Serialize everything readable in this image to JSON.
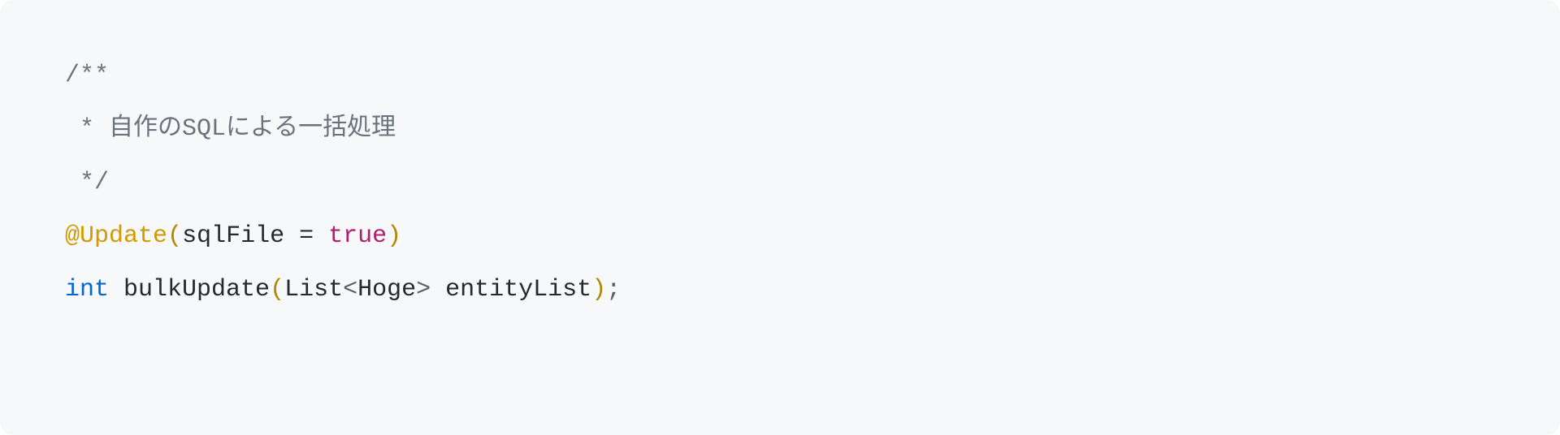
{
  "code": {
    "comment_open": "/**",
    "comment_body": " * 自作のSQLによる一括処理",
    "comment_close": " */",
    "annotation_at": "@",
    "annotation_name": "Update",
    "annotation_param": "sqlFile",
    "annotation_eq": " = ",
    "annotation_value": "true",
    "return_type": "int",
    "method_name": "bulkUpdate",
    "param_type_outer": "List",
    "param_type_inner": "Hoge",
    "param_name": "entityList"
  }
}
